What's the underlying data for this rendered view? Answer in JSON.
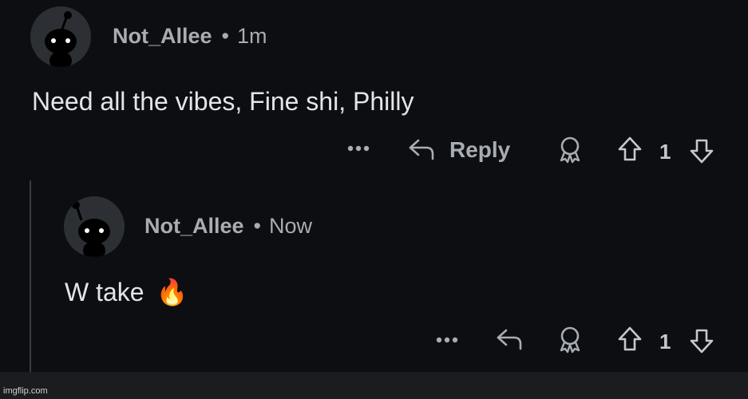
{
  "comment": {
    "author": "Not_Allee",
    "separator": "•",
    "time": "1m",
    "body": "Need all the vibes, Fine shi, Philly",
    "actions": {
      "more_label": "•••",
      "reply_label": "Reply",
      "vote_count": "1"
    }
  },
  "reply": {
    "author": "Not_Allee",
    "separator": "•",
    "time": "Now",
    "body": "W take",
    "emoji": "🔥",
    "actions": {
      "more_label": "•••",
      "vote_count": "1"
    }
  },
  "watermark": "imgflip.com",
  "colors": {
    "background": "#0c0e11",
    "text": "#e3e5e8",
    "muted": "#a8acb3",
    "avatar_bg": "#2c2f33"
  },
  "icons": {
    "avatar": "snoo-avatar-icon",
    "reply": "reply-arrow-icon",
    "award": "award-icon",
    "upvote": "upvote-arrow-icon",
    "downvote": "downvote-arrow-icon",
    "more": "more-options-icon"
  }
}
